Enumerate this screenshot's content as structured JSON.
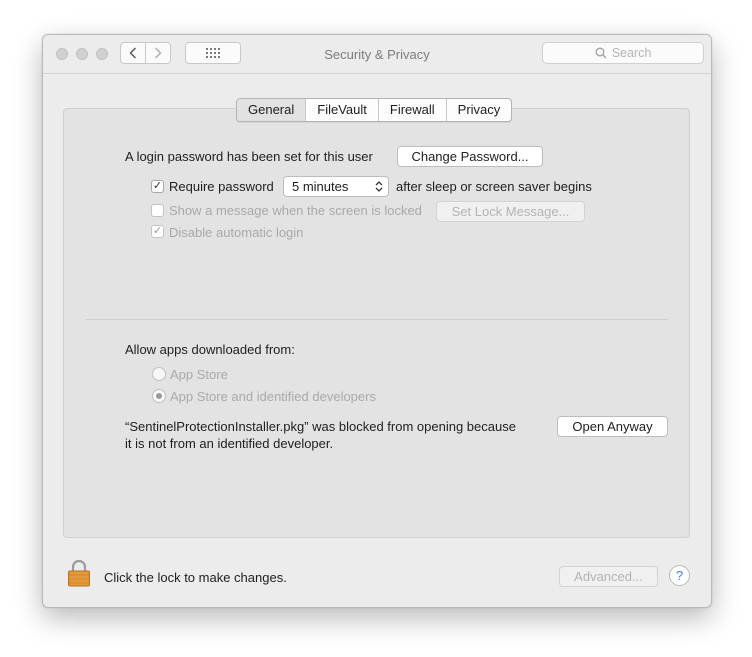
{
  "window": {
    "title": "Security & Privacy"
  },
  "search": {
    "placeholder": "Search"
  },
  "tabs": [
    {
      "label": "General",
      "active": true
    },
    {
      "label": "FileVault",
      "active": false
    },
    {
      "label": "Firewall",
      "active": false
    },
    {
      "label": "Privacy",
      "active": false
    }
  ],
  "general": {
    "login_password_text": "A login password has been set for this user",
    "change_password_label": "Change Password...",
    "require_password": {
      "label": "Require password",
      "checked": true
    },
    "require_password_delay": "5 minutes",
    "require_password_suffix": "after sleep or screen saver begins",
    "show_message": {
      "label": "Show a message when the screen is locked",
      "checked": false
    },
    "set_lock_message_label": "Set Lock Message...",
    "disable_auto_login": {
      "label": "Disable automatic login",
      "checked": true
    }
  },
  "allow_apps": {
    "heading": "Allow apps downloaded from:",
    "options": [
      {
        "label": "App Store",
        "selected": false
      },
      {
        "label": "App Store and identified developers",
        "selected": true
      }
    ],
    "blocked_line1": "“SentinelProtectionInstaller.pkg” was blocked from opening because",
    "blocked_line2": "it is not from an identified developer.",
    "open_anyway_label": "Open Anyway"
  },
  "footer": {
    "lock_text": "Click the lock to make changes.",
    "advanced_label": "Advanced...",
    "help_label": "?"
  },
  "colors": {
    "lock": "#e39a3b",
    "help_accent": "#3b83e4"
  }
}
